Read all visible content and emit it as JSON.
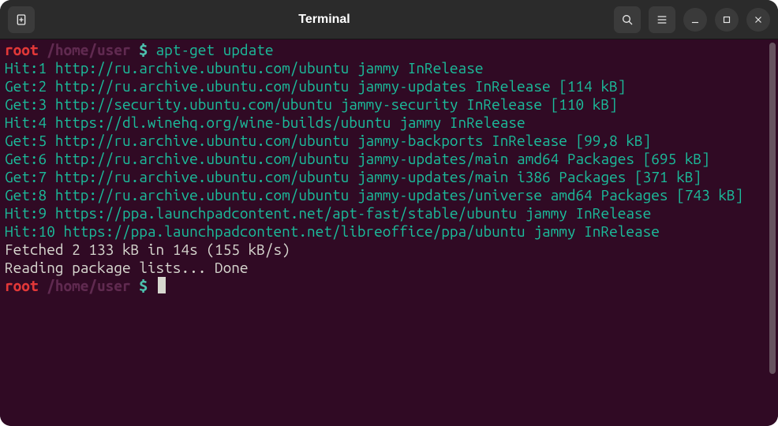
{
  "titlebar": {
    "title": "Terminal"
  },
  "prompt": {
    "user": "root",
    "path": "/home/user",
    "symbol": "$"
  },
  "command": "apt-get update",
  "output_lines": [
    "Hit:1 http://ru.archive.ubuntu.com/ubuntu jammy InRelease",
    "Get:2 http://ru.archive.ubuntu.com/ubuntu jammy-updates InRelease [114 kB]",
    "Get:3 http://security.ubuntu.com/ubuntu jammy-security InRelease [110 kB]",
    "Hit:4 https://dl.winehq.org/wine-builds/ubuntu jammy InRelease",
    "Get:5 http://ru.archive.ubuntu.com/ubuntu jammy-backports InRelease [99,8 kB]",
    "Get:6 http://ru.archive.ubuntu.com/ubuntu jammy-updates/main amd64 Packages [695 kB]",
    "Get:7 http://ru.archive.ubuntu.com/ubuntu jammy-updates/main i386 Packages [371 kB]",
    "Get:8 http://ru.archive.ubuntu.com/ubuntu jammy-updates/universe amd64 Packages [743 kB]",
    "Hit:9 https://ppa.launchpadcontent.net/apt-fast/stable/ubuntu jammy InRelease",
    "Hit:10 https://ppa.launchpadcontent.net/libreoffice/ppa/ubuntu jammy InRelease"
  ],
  "summary_lines": [
    "Fetched 2 133 kB in 14s (155 kB/s)",
    "Reading package lists... Done"
  ]
}
